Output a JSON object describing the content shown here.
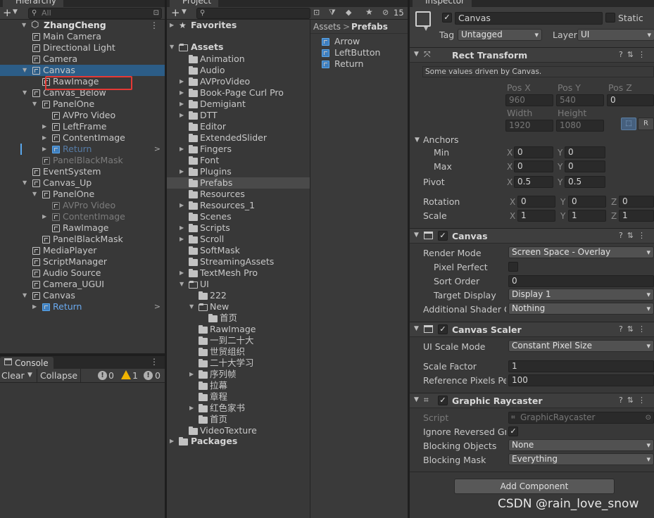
{
  "hierarchy": {
    "tab": "Hierarchy",
    "search_placeholder": "All",
    "scene": "ZhangCheng",
    "rows": [
      {
        "label": "Main Camera"
      },
      {
        "label": "Directional Light"
      },
      {
        "label": "Camera"
      },
      {
        "label": "Canvas"
      },
      {
        "label": "RawImage"
      },
      {
        "label": "Canvas_Below"
      },
      {
        "label": "PanelOne"
      },
      {
        "label": "AVPro Video"
      },
      {
        "label": "LeftFrame"
      },
      {
        "label": "ContentImage"
      },
      {
        "label": "Return"
      },
      {
        "label": "PanelBlackMask"
      },
      {
        "label": "EventSystem"
      },
      {
        "label": "Canvas_Up"
      },
      {
        "label": "PanelOne"
      },
      {
        "label": "AVPro Video"
      },
      {
        "label": "ContentImage"
      },
      {
        "label": "RawImage"
      },
      {
        "label": "PanelBlackMask"
      },
      {
        "label": "MediaPlayer"
      },
      {
        "label": "ScriptManager"
      },
      {
        "label": "Audio Source"
      },
      {
        "label": "Camera_UGUI"
      },
      {
        "label": "Canvas"
      },
      {
        "label": "Return"
      }
    ]
  },
  "console": {
    "tab": "Console",
    "clear": "Clear",
    "collapse": "Collapse",
    "errors": "0",
    "warnings": "1",
    "infos": "0"
  },
  "project": {
    "tab": "Project",
    "hidden_count": "15",
    "favorites": "Favorites",
    "assets": "Assets",
    "folders": [
      "Animation",
      "Audio",
      "AVProVideo",
      "Book-Page Curl Pro",
      "Demigiant",
      "DTT",
      "Editor",
      "ExtendedSlider",
      "Fingers",
      "Font",
      "Plugins",
      "Prefabs",
      "Resources",
      "Resources_1",
      "Scenes",
      "Scripts",
      "Scroll",
      "SoftMask",
      "StreamingAssets",
      "TextMesh Pro",
      "UI",
      "222",
      "New",
      "首页",
      "RawImage",
      "一到二十大",
      "世贸组织",
      "二十大学习",
      "序列帧",
      "拉幕",
      "章程",
      "红色家书",
      "首页",
      "VideoTexture"
    ],
    "packages": "Packages",
    "breadcrumb": [
      "Assets",
      "Prefabs"
    ],
    "prefabs": [
      "Arrow",
      "LeftButton",
      "Return"
    ]
  },
  "inspector": {
    "tab": "Inspector",
    "object_name": "Canvas",
    "static_label": "Static",
    "tag_label": "Tag",
    "tag_value": "Untagged",
    "layer_label": "Layer",
    "layer_value": "UI",
    "rect": {
      "title": "Rect Transform",
      "note": "Some values driven by Canvas.",
      "posx_label": "Pos X",
      "posy_label": "Pos Y",
      "posz_label": "Pos Z",
      "posx": "960",
      "posy": "540",
      "posz": "0",
      "width_label": "Width",
      "height_label": "Height",
      "width": "1920",
      "height": "1080",
      "r_btn": "R",
      "anchors": "Anchors",
      "min": "Min",
      "max": "Max",
      "pivot": "Pivot",
      "min_x": "0",
      "min_y": "0",
      "max_x": "0",
      "max_y": "0",
      "pivot_x": "0.5",
      "pivot_y": "0.5",
      "rotation": "Rotation",
      "scale": "Scale",
      "rot_x": "0",
      "rot_y": "0",
      "rot_z": "0",
      "scl_x": "1",
      "scl_y": "1",
      "scl_z": "1",
      "x": "X",
      "y": "Y",
      "z": "Z"
    },
    "canvas": {
      "title": "Canvas",
      "render_mode_label": "Render Mode",
      "render_mode": "Screen Space - Overlay",
      "pixel_perfect_label": "Pixel Perfect",
      "sort_order_label": "Sort Order",
      "sort_order": "0",
      "target_display_label": "Target Display",
      "target_display": "Display 1",
      "shader_label": "Additional Shader Ch",
      "shader": "Nothing"
    },
    "scaler": {
      "title": "Canvas Scaler",
      "mode_label": "UI Scale Mode",
      "mode": "Constant Pixel Size",
      "factor_label": "Scale Factor",
      "factor": "1",
      "ref_label": "Reference Pixels Per",
      "ref": "100"
    },
    "raycaster": {
      "title": "Graphic Raycaster",
      "script_label": "Script",
      "script": "GraphicRaycaster",
      "ignore_label": "Ignore Reversed Grap",
      "blocking_objects_label": "Blocking Objects",
      "blocking_objects": "None",
      "blocking_mask_label": "Blocking Mask",
      "blocking_mask": "Everything"
    },
    "add_component": "Add Component"
  },
  "watermark": "CSDN @rain_love_snow"
}
